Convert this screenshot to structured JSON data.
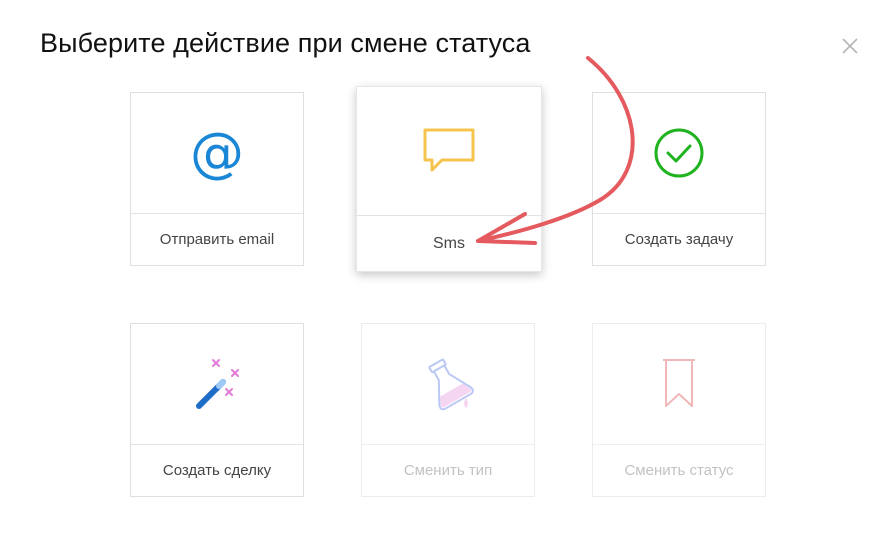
{
  "dialog": {
    "title": "Выберите действие при смене статуса"
  },
  "actions": [
    {
      "label": "Отправить email",
      "icon": "at-sign-icon",
      "color": "#1a86d6",
      "enabled": true
    },
    {
      "label": "Sms",
      "icon": "chat-bubble-icon",
      "color": "#f6c34d",
      "enabled": true,
      "highlighted": true
    },
    {
      "label": "Создать задачу",
      "icon": "check-circle-icon",
      "color": "#20b320",
      "enabled": true
    },
    {
      "label": "Создать сделку",
      "icon": "magic-wand-icon",
      "color": "#1f6cc9",
      "enabled": true
    },
    {
      "label": "Сменить тип",
      "icon": "flask-icon",
      "color": "#b9c8f5",
      "enabled": false
    },
    {
      "label": "Сменить статус",
      "icon": "bookmark-icon",
      "color": "#f0b8b8",
      "enabled": false
    }
  ],
  "annotation": {
    "arrow_color": "#e45a5e"
  }
}
